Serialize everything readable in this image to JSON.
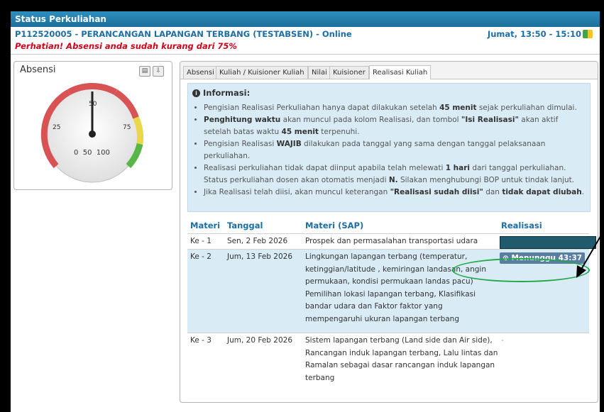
{
  "header": {
    "title": "Status Perkuliahan",
    "course": "P112520005 - PERANCANGAN LAPANGAN TERBANG (TESTABSEN) - Online",
    "time": "Jumat, 13:50 - 15:10",
    "warning": "Perhatian! Absensi anda sudah kurang dari 75%"
  },
  "absensi": {
    "title": "Absensi",
    "gauge": {
      "value_label": "0  50  100",
      "tick_50": "50",
      "tick_25": "25",
      "tick_75": "75",
      "value": 50,
      "min": 0,
      "max": 100
    }
  },
  "tabs": [
    "Absensi",
    "Kuliah / Kuisioner Kuliah",
    "Nilai",
    "Kuisioner",
    "Realisasi Kuliah"
  ],
  "active_tab": "Realisasi Kuliah",
  "info": {
    "title": "Informasi:",
    "items": [
      {
        "parts": [
          {
            "t": "Pengisian Realisasi Perkuliahan hanya dapat dilakukan setelah "
          },
          {
            "b": "45 menit"
          },
          {
            "t": " sejak perkuliahan dimulai."
          }
        ]
      },
      {
        "parts": [
          {
            "b": "Penghitung waktu"
          },
          {
            "t": " akan muncul pada kolom Realisasi, dan tombol "
          },
          {
            "b": "\"Isi Realisasi\""
          },
          {
            "t": " akan aktif setelah batas waktu "
          },
          {
            "b": "45 menit"
          },
          {
            "t": " terpenuhi."
          }
        ]
      },
      {
        "parts": [
          {
            "t": "Pengisian Realisasi "
          },
          {
            "b": "WAJIB"
          },
          {
            "t": " dilakukan pada tanggal yang sama dengan tanggal pelaksanaan perkuliahan."
          }
        ]
      },
      {
        "parts": [
          {
            "t": "Realisasi perkuliahan tidak dapat diinput apabila telah melewati "
          },
          {
            "b": "1 hari"
          },
          {
            "t": " dari tanggal perkuliahan. Status perkuliahan dosen akan otomatis menjadi "
          },
          {
            "b": "N."
          },
          {
            "t": " Silakan menghubungi BOP untuk tindak lanjut."
          }
        ]
      },
      {
        "parts": [
          {
            "t": "Jika Realisasi telah diisi, akan muncul keterangan "
          },
          {
            "b": "\"Realisasi sudah diisi\""
          },
          {
            "t": " dan "
          },
          {
            "b": "tidak dapat diubah"
          },
          {
            "t": "."
          }
        ]
      }
    ]
  },
  "table": {
    "headers": [
      "Materi",
      "Tanggal",
      "Materi (SAP)",
      "Realisasi"
    ],
    "rows": [
      {
        "materi": "Ke - 1",
        "tanggal": "Sen, 2 Feb 2026",
        "sap": [
          "Prospek dan permasalahan transportasi udara"
        ],
        "realisasi": ""
      },
      {
        "materi": "Ke - 2",
        "tanggal": "Jum, 13 Feb 2026",
        "sap": [
          "Lingkungan lapangan terbang (temperatur,",
          "ketinggian/latitude , kemiringan landasan, angin",
          "permukaan, kondisi permukaan landas pacu)",
          "Pemilihan lokasi lapangan terbang, Klasifikasi",
          "bandar udara dan Faktor faktor yang",
          "mempengaruhi ukuran lapangan terbang"
        ],
        "realisasi": "Menunggu 43:37"
      },
      {
        "materi": "Ke - 3",
        "tanggal": "Jum, 20 Feb 2026",
        "sap": [
          "Sistem lapangan terbang (Land side dan Air side),",
          "Rancangan induk lapangan terbang, Lalu lintas dan",
          "Ramalan sebagai dasar rancangan induk lapangan",
          "terbang"
        ],
        "realisasi": "-"
      }
    ]
  },
  "colors": {
    "title_bar": "#1d6e9a",
    "link_blue": "#1c6ea4",
    "warning_red": "#d0021b",
    "info_bg": "#d9ecf6",
    "highlight_ellipse": "#22a84a"
  }
}
